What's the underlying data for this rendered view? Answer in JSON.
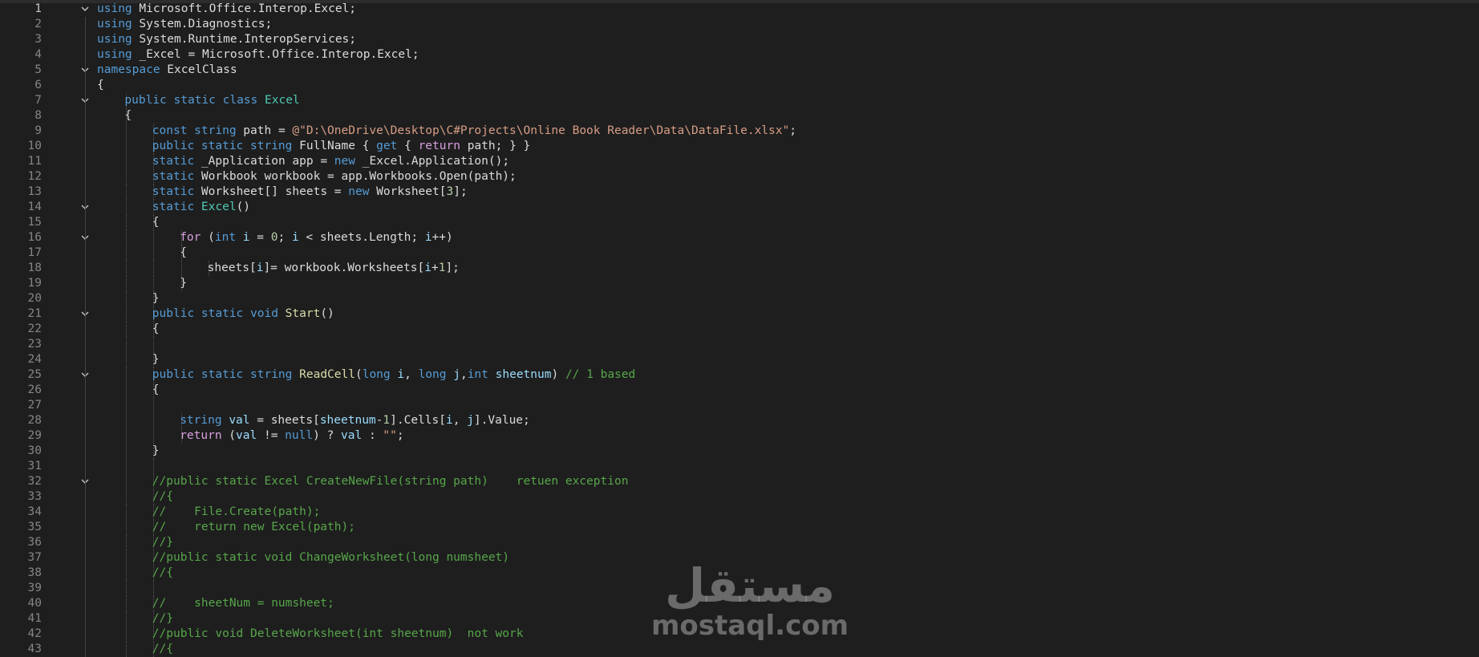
{
  "editor": {
    "colors": {
      "background": "#1e1e1e",
      "keyword": "#569cd6",
      "control_keyword": "#d8a0df",
      "type": "#4ec9b0",
      "string": "#d69d85",
      "comment": "#57a64a",
      "method": "#dcdcaa",
      "local": "#9cdcfe",
      "number": "#b5cea8",
      "line_number": "#858585"
    },
    "lines": [
      {
        "n": "1",
        "fold": true,
        "indent": 0,
        "tokens": [
          [
            "kw",
            "using"
          ],
          [
            "t",
            " Microsoft.Office.Interop.Excel;"
          ]
        ]
      },
      {
        "n": "2",
        "fold": false,
        "indent": 0,
        "tokens": [
          [
            "kw",
            "using"
          ],
          [
            "t",
            " System.Diagnostics;"
          ]
        ]
      },
      {
        "n": "3",
        "fold": false,
        "indent": 0,
        "tokens": [
          [
            "kw",
            "using"
          ],
          [
            "t",
            " System.Runtime.InteropServices;"
          ]
        ]
      },
      {
        "n": "4",
        "fold": false,
        "indent": 0,
        "tokens": [
          [
            "kw",
            "using"
          ],
          [
            "t",
            " _Excel = Microsoft.Office.Interop.Excel;"
          ]
        ]
      },
      {
        "n": "5",
        "fold": true,
        "indent": 0,
        "tokens": [
          [
            "kw",
            "namespace"
          ],
          [
            "t",
            " ExcelClass"
          ]
        ]
      },
      {
        "n": "6",
        "fold": false,
        "indent": 0,
        "tokens": [
          [
            "t",
            "{"
          ]
        ]
      },
      {
        "n": "7",
        "fold": true,
        "indent": 1,
        "tokens": [
          [
            "kw",
            "public static class "
          ],
          [
            "cls",
            "Excel"
          ]
        ]
      },
      {
        "n": "8",
        "fold": false,
        "indent": 1,
        "tokens": [
          [
            "t",
            "{"
          ]
        ]
      },
      {
        "n": "9",
        "fold": false,
        "indent": 2,
        "tokens": [
          [
            "kw",
            "const string"
          ],
          [
            "t",
            " path = "
          ],
          [
            "str",
            "@\"D:\\OneDrive\\Desktop\\C#Projects\\Online Book Reader\\Data\\DataFile.xlsx\""
          ],
          [
            "t",
            ";"
          ]
        ]
      },
      {
        "n": "10",
        "fold": false,
        "indent": 2,
        "tokens": [
          [
            "kw",
            "public static string"
          ],
          [
            "t",
            " FullName { "
          ],
          [
            "kw",
            "get"
          ],
          [
            "t",
            " { "
          ],
          [
            "kw2",
            "return"
          ],
          [
            "t",
            " path; } }"
          ]
        ]
      },
      {
        "n": "11",
        "fold": false,
        "indent": 2,
        "tokens": [
          [
            "kw",
            "static"
          ],
          [
            "t",
            " _Application app = "
          ],
          [
            "kw",
            "new"
          ],
          [
            "t",
            " _Excel.Application();"
          ]
        ]
      },
      {
        "n": "12",
        "fold": false,
        "indent": 2,
        "tokens": [
          [
            "kw",
            "static"
          ],
          [
            "t",
            " Workbook workbook = app.Workbooks.Open(path);"
          ]
        ]
      },
      {
        "n": "13",
        "fold": false,
        "indent": 2,
        "tokens": [
          [
            "kw",
            "static"
          ],
          [
            "t",
            " Worksheet[] sheets = "
          ],
          [
            "kw",
            "new"
          ],
          [
            "t",
            " Worksheet["
          ],
          [
            "num",
            "3"
          ],
          [
            "t",
            "];"
          ]
        ]
      },
      {
        "n": "14",
        "fold": true,
        "indent": 2,
        "tokens": [
          [
            "kw",
            "static"
          ],
          [
            "t",
            " "
          ],
          [
            "cls",
            "Excel"
          ],
          [
            "t",
            "()"
          ]
        ]
      },
      {
        "n": "15",
        "fold": false,
        "indent": 2,
        "tokens": [
          [
            "t",
            "{"
          ]
        ]
      },
      {
        "n": "16",
        "fold": true,
        "indent": 3,
        "tokens": [
          [
            "kw2",
            "for"
          ],
          [
            "t",
            " ("
          ],
          [
            "kw",
            "int"
          ],
          [
            "t",
            " "
          ],
          [
            "var",
            "i"
          ],
          [
            "t",
            " = "
          ],
          [
            "num",
            "0"
          ],
          [
            "t",
            "; "
          ],
          [
            "var",
            "i"
          ],
          [
            "t",
            " < sheets.Length; "
          ],
          [
            "var",
            "i"
          ],
          [
            "t",
            "++)"
          ]
        ]
      },
      {
        "n": "17",
        "fold": false,
        "indent": 3,
        "tokens": [
          [
            "t",
            "{"
          ]
        ]
      },
      {
        "n": "18",
        "fold": false,
        "indent": 4,
        "tokens": [
          [
            "t",
            "sheets["
          ],
          [
            "var",
            "i"
          ],
          [
            "t",
            "]= workbook.Worksheets["
          ],
          [
            "var",
            "i"
          ],
          [
            "t",
            "+"
          ],
          [
            "num",
            "1"
          ],
          [
            "t",
            "];"
          ]
        ]
      },
      {
        "n": "19",
        "fold": false,
        "indent": 3,
        "tokens": [
          [
            "t",
            "}"
          ]
        ]
      },
      {
        "n": "20",
        "fold": false,
        "indent": 2,
        "tokens": [
          [
            "t",
            "}"
          ]
        ]
      },
      {
        "n": "21",
        "fold": true,
        "indent": 2,
        "tokens": [
          [
            "kw",
            "public static void"
          ],
          [
            "t",
            " "
          ],
          [
            "fn",
            "Start"
          ],
          [
            "t",
            "()"
          ]
        ]
      },
      {
        "n": "22",
        "fold": false,
        "indent": 2,
        "tokens": [
          [
            "t",
            "{"
          ]
        ]
      },
      {
        "n": "23",
        "fold": false,
        "indent": 2,
        "tokens": []
      },
      {
        "n": "24",
        "fold": false,
        "indent": 2,
        "tokens": [
          [
            "t",
            "}"
          ]
        ]
      },
      {
        "n": "25",
        "fold": true,
        "indent": 2,
        "tokens": [
          [
            "kw",
            "public static string"
          ],
          [
            "t",
            " "
          ],
          [
            "fn",
            "ReadCell"
          ],
          [
            "t",
            "("
          ],
          [
            "kw",
            "long"
          ],
          [
            "t",
            " "
          ],
          [
            "var",
            "i"
          ],
          [
            "t",
            ", "
          ],
          [
            "kw",
            "long"
          ],
          [
            "t",
            " "
          ],
          [
            "var",
            "j"
          ],
          [
            "t",
            ","
          ],
          [
            "kw",
            "int"
          ],
          [
            "t",
            " "
          ],
          [
            "var",
            "sheetnum"
          ],
          [
            "t",
            ") "
          ],
          [
            "cm",
            "// 1 based"
          ]
        ]
      },
      {
        "n": "26",
        "fold": false,
        "indent": 2,
        "tokens": [
          [
            "t",
            "{"
          ]
        ]
      },
      {
        "n": "27",
        "fold": false,
        "indent": 2,
        "tokens": []
      },
      {
        "n": "28",
        "fold": false,
        "indent": 3,
        "tokens": [
          [
            "kw",
            "string"
          ],
          [
            "t",
            " "
          ],
          [
            "var",
            "val"
          ],
          [
            "t",
            " = sheets["
          ],
          [
            "var",
            "sheetnum"
          ],
          [
            "t",
            "-"
          ],
          [
            "num",
            "1"
          ],
          [
            "t",
            "].Cells["
          ],
          [
            "var",
            "i"
          ],
          [
            "t",
            ", "
          ],
          [
            "var",
            "j"
          ],
          [
            "t",
            "].Value;"
          ]
        ]
      },
      {
        "n": "29",
        "fold": false,
        "indent": 3,
        "tokens": [
          [
            "kw2",
            "return"
          ],
          [
            "t",
            " ("
          ],
          [
            "var",
            "val"
          ],
          [
            "t",
            " != "
          ],
          [
            "kw",
            "null"
          ],
          [
            "t",
            ") ? "
          ],
          [
            "var",
            "val"
          ],
          [
            "t",
            " : "
          ],
          [
            "str",
            "\"\""
          ],
          [
            "t",
            ";"
          ]
        ]
      },
      {
        "n": "30",
        "fold": false,
        "indent": 2,
        "tokens": [
          [
            "t",
            "}"
          ]
        ]
      },
      {
        "n": "31",
        "fold": false,
        "indent": 2,
        "tokens": []
      },
      {
        "n": "32",
        "fold": true,
        "indent": 2,
        "tokens": [
          [
            "cm",
            "//public static Excel CreateNewFile(string path)    retuen exception"
          ]
        ]
      },
      {
        "n": "33",
        "fold": false,
        "indent": 2,
        "tokens": [
          [
            "cm",
            "//{"
          ]
        ]
      },
      {
        "n": "34",
        "fold": false,
        "indent": 2,
        "tokens": [
          [
            "cm",
            "//    File.Create(path);"
          ]
        ]
      },
      {
        "n": "35",
        "fold": false,
        "indent": 2,
        "tokens": [
          [
            "cm",
            "//    return new Excel(path);"
          ]
        ]
      },
      {
        "n": "36",
        "fold": false,
        "indent": 2,
        "tokens": [
          [
            "cm",
            "//}"
          ]
        ]
      },
      {
        "n": "37",
        "fold": false,
        "indent": 2,
        "tokens": [
          [
            "cm",
            "//public static void ChangeWorksheet(long numsheet)"
          ]
        ]
      },
      {
        "n": "38",
        "fold": false,
        "indent": 2,
        "tokens": [
          [
            "cm",
            "//{"
          ]
        ]
      },
      {
        "n": "39",
        "fold": false,
        "indent": 2,
        "tokens": []
      },
      {
        "n": "40",
        "fold": false,
        "indent": 2,
        "tokens": [
          [
            "cm",
            "//    sheetNum = numsheet;"
          ]
        ]
      },
      {
        "n": "41",
        "fold": false,
        "indent": 2,
        "tokens": [
          [
            "cm",
            "//}"
          ]
        ]
      },
      {
        "n": "42",
        "fold": false,
        "indent": 2,
        "tokens": [
          [
            "cm",
            "//public void DeleteWorksheet(int sheetnum)  not work"
          ]
        ]
      },
      {
        "n": "43",
        "fold": false,
        "indent": 2,
        "tokens": [
          [
            "cm",
            "//{"
          ]
        ]
      }
    ]
  },
  "watermark": {
    "arabic": "مستقل",
    "latin": "mostaql.com"
  }
}
